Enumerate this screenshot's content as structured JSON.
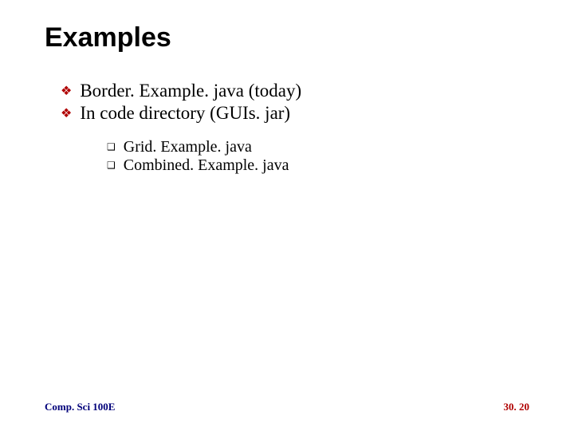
{
  "title": "Examples",
  "bullets_l1": [
    "Border. Example. java (today)",
    "In code directory (GUIs. jar)"
  ],
  "bullets_l2": [
    "Grid. Example. java",
    "Combined. Example. java"
  ],
  "footer": {
    "course": "Comp. Sci 100E",
    "page": "30. 20"
  },
  "markers": {
    "l1": "❖",
    "l2": "❑"
  }
}
